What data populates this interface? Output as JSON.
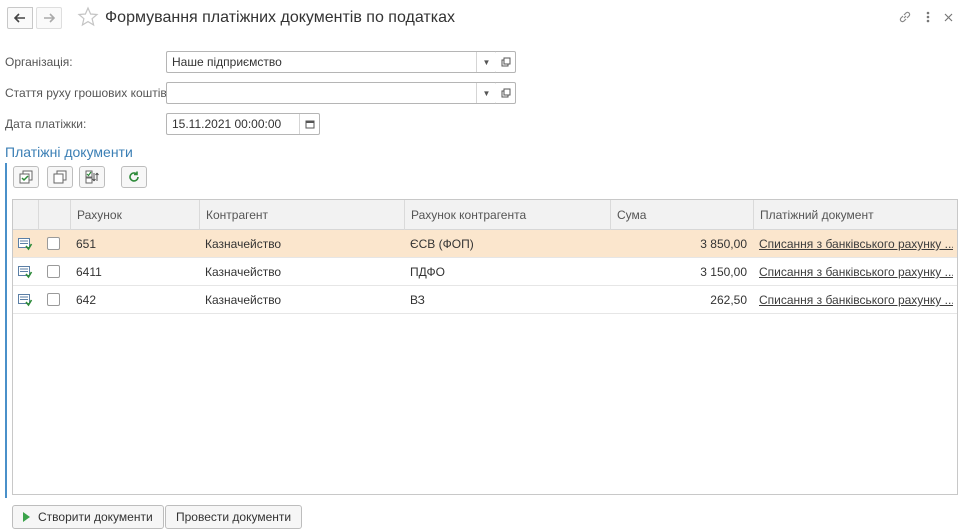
{
  "window": {
    "title": "Формування платіжних документів по податках"
  },
  "form": {
    "organization": {
      "label": "Організація:",
      "value": "Наше підприємство"
    },
    "cashflow_item": {
      "label": "Стаття руху грошових коштів:",
      "value": ""
    },
    "payment_date": {
      "label": "Дата платіжки:",
      "value": "15.11.2021 00:00:00"
    }
  },
  "section": {
    "title": "Платіжні документи"
  },
  "table": {
    "columns": [
      "Рахунок",
      "Контрагент",
      "Рахунок контрагента",
      "Сума",
      "Платіжний документ"
    ],
    "rows": [
      {
        "account": "651",
        "counterparty": "Казначейство",
        "counterparty_account": "ЄСВ (ФОП)",
        "amount": "3 850,00",
        "document": "Списання з банківського рахунку ...",
        "selected": true,
        "checked": false
      },
      {
        "account": "6411",
        "counterparty": "Казначейство",
        "counterparty_account": "ПДФО",
        "amount": "3 150,00",
        "document": "Списання з банківського рахунку ...",
        "selected": false,
        "checked": false
      },
      {
        "account": "642",
        "counterparty": "Казначейство",
        "counterparty_account": "ВЗ",
        "amount": "262,50",
        "document": "Списання з банківського рахунку ...",
        "selected": false,
        "checked": false
      }
    ]
  },
  "buttons": {
    "create": "Створити документи",
    "post": "Провести документи"
  },
  "icons": {
    "back": "arrow-left-icon",
    "forward": "arrow-right-icon",
    "favorite": "star-icon",
    "link": "link-icon",
    "more": "more-vertical-icon",
    "close": "close-icon",
    "toolbar": [
      "check-all-icon",
      "uncheck-all-icon",
      "toggle-check-icon",
      "refresh-icon"
    ],
    "row": "document-icon"
  },
  "colors": {
    "accent": "#4a90c9",
    "selected_row": "#fbe6cd",
    "section_title": "#3b7fb5",
    "play": "#3aa34a"
  }
}
